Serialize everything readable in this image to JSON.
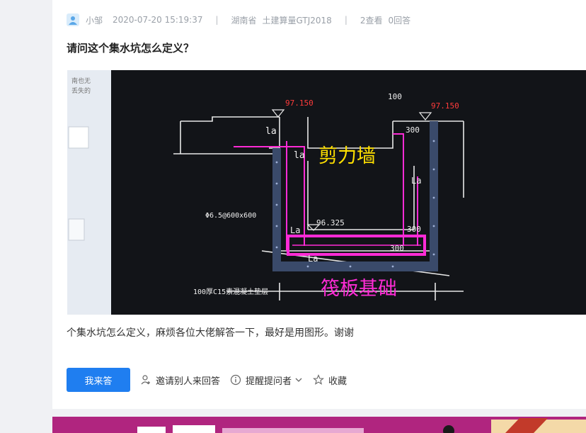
{
  "post": {
    "author": "小邹",
    "datetime": "2020-07-20 15:19:37",
    "region": "湖南省",
    "software": "土建算量GTJ2018",
    "views": "2查看",
    "answers": "0回答",
    "title": "请问这个集水坑怎么定义？",
    "description": "个集水坑怎么定义，麻烦各位大佬解答一下，最好是用图形。谢谢"
  },
  "photo": {
    "text_labels": {
      "shear_wall": "剪力墙",
      "raft_foundation": "筏板基础",
      "elev_left": "97.150",
      "elev_right": "97.150",
      "elev_bottom": "96.325",
      "dim_100": "100",
      "dim_300_top": "300",
      "dim_300_mid": "300",
      "dim_300_low": "300",
      "la_1": "la",
      "la_2": "la",
      "la_3": "La",
      "la_4": "La",
      "la_5": "La",
      "rebar_spec": "Φ6.5@600x600",
      "bedding": "100厚C15素混凝土垫层",
      "left_note_1": "南也无",
      "left_note_2": "丢失的"
    }
  },
  "actions": {
    "answer": "我来答",
    "invite": "邀请别人来回答",
    "remind": "提醒提问者",
    "favorite": "收藏"
  },
  "colors": {
    "primary": "#1f7ef0",
    "highlight_magenta": "#ff2bd6",
    "label_yellow": "#ffe000",
    "banner": "#b0257f"
  }
}
